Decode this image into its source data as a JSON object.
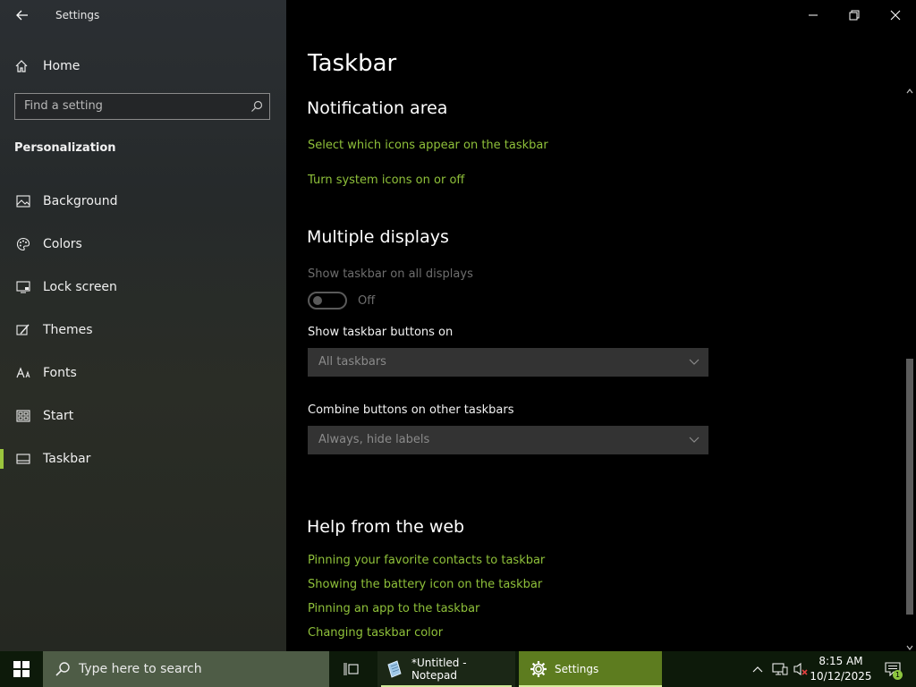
{
  "window": {
    "app_title": "Settings",
    "sidebar": {
      "home_label": "Home",
      "search_placeholder": "Find a setting",
      "section_title": "Personalization",
      "items": [
        {
          "label": "Background",
          "icon": "picture-icon"
        },
        {
          "label": "Colors",
          "icon": "palette-icon"
        },
        {
          "label": "Lock screen",
          "icon": "monitor-icon"
        },
        {
          "label": "Themes",
          "icon": "brush-icon"
        },
        {
          "label": "Fonts",
          "icon": "fonts-icon"
        },
        {
          "label": "Start",
          "icon": "start-grid-icon"
        },
        {
          "label": "Taskbar",
          "icon": "taskbar-icon",
          "active": true
        }
      ]
    },
    "main": {
      "page_title": "Taskbar",
      "notification_area": {
        "heading": "Notification area",
        "links": [
          "Select which icons appear on the taskbar",
          "Turn system icons on or off"
        ]
      },
      "multiple_displays": {
        "heading": "Multiple displays",
        "show_on_all_label": "Show taskbar on all displays",
        "toggle_state": "Off",
        "buttons_on_label": "Show taskbar buttons on",
        "buttons_on_value": "All taskbars",
        "combine_label": "Combine buttons on other taskbars",
        "combine_value": "Always, hide labels"
      },
      "help": {
        "heading": "Help from the web",
        "links": [
          "Pinning your favorite contacts to taskbar",
          "Showing the battery icon on the taskbar",
          "Pinning an app to the taskbar",
          "Changing taskbar color"
        ]
      }
    }
  },
  "taskbar": {
    "search_placeholder": "Type here to search",
    "apps": [
      {
        "label": "*Untitled - Notepad",
        "icon": "notepad-icon"
      },
      {
        "label": "Settings",
        "icon": "gear-icon",
        "active": true
      }
    ],
    "time": "8:15 AM",
    "date": "10/12/2025",
    "notification_count": "1"
  },
  "colors": {
    "accent": "#8fc13a",
    "settings_taskbar_active": "#5d7c1f"
  }
}
